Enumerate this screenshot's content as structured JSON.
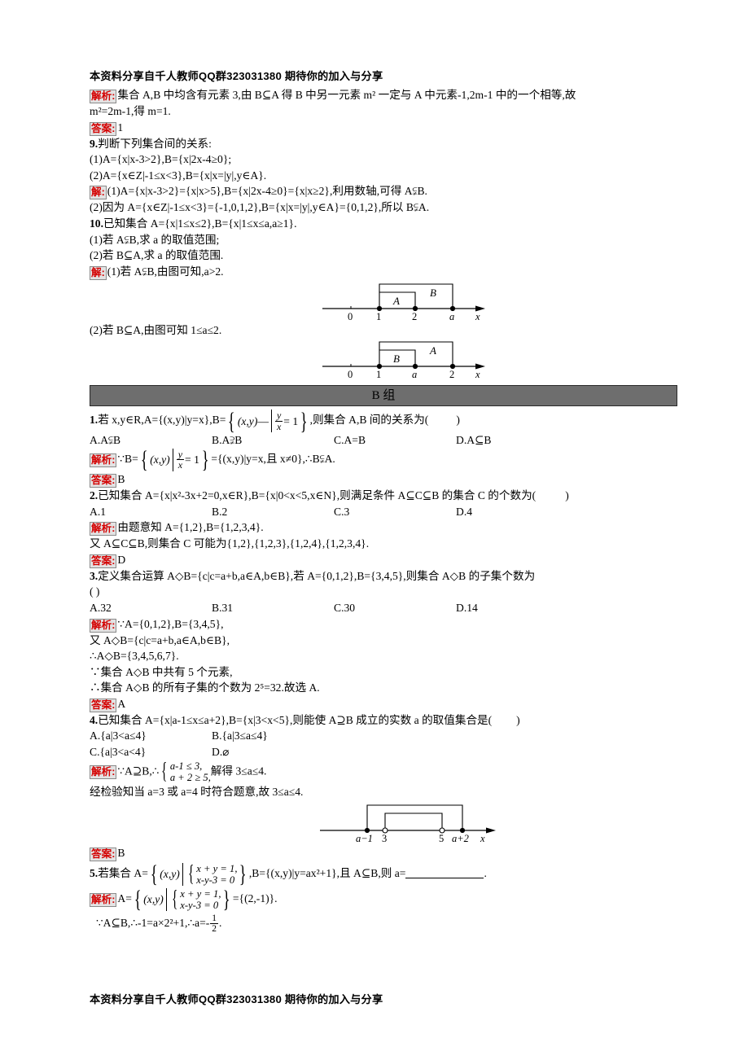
{
  "header": {
    "text": "本资料分享自千人教师QQ群323031380 期待你的加入与分享"
  },
  "footer": {
    "text": "本资料分享自千人教师QQ群323031380 期待你的加入与分享"
  },
  "tags": {
    "analysis": "解析:",
    "solution": "解:",
    "answer": "答案:"
  },
  "section_a_tail": {
    "q8_analysis": "集合 A,B 中均含有元素 3,由 B⊆A 得 B 中另一元素 m² 一定与 A 中元素-1,2m-1 中的一个相等,故",
    "q8_analysis_2": "m²=2m-1,得 m=1.",
    "q8_answer": "1",
    "q9_stem": "判断下列集合间的关系:",
    "q9_num": "9.",
    "q9_sub1": "(1)A={x|x-3>2},B={x|2x-4≥0};",
    "q9_sub2": "(2)A={x∈Z|-1≤x<3},B={x|x=|y|,y∈A}.",
    "q9_sol1": "(1)A={x|x-3>2}={x|x>5},B={x|2x-4≥0}={x|x≥2},利用数轴,可得 A⫋B.",
    "q9_sol2": "(2)因为 A={x∈Z|-1≤x<3}={-1,0,1,2},B={x|x=|y|,y∈A}={0,1,2},所以 B⫋A.",
    "q10_num": "10.",
    "q10_stem": "已知集合 A={x|1≤x≤2},B={x|1≤x≤a,a≥1}.",
    "q10_sub1": "(1)若 A⫋B,求 a 的取值范围;",
    "q10_sub2": "(2)若 B⊆A,求 a 的取值范围.",
    "q10_sol1": "(1)若 A⫋B,由图可知,a>2.",
    "q10_sol2": "(2)若 B⊆A,由图可知 1≤a≤2."
  },
  "band_b": {
    "label": "B 组"
  },
  "section_b": {
    "q1": {
      "num": "1.",
      "stem_pre": "若 x,y∈R,A={(x,y)|y=x},B=",
      "stem_set_lead": "(x,y)",
      "frac_num": "y",
      "frac_den": "x",
      "frac_eq": "= 1",
      "stem_post": ",则集合 A,B 间的关系为(",
      "stem_close": ")",
      "options": [
        "A.A⫋B",
        "B.A⫌B",
        "C.A=B",
        "D.A⊆B"
      ],
      "analysis_pre": "∵B=",
      "analysis_set_lead": "(x,y)",
      "analysis_post": "={(x,y)|y=x,且 x≠0},∴B⫋A.",
      "answer": "B"
    },
    "q2": {
      "num": "2.",
      "stem": "已知集合 A={x|x²-3x+2=0,x∈R},B={x|0<x<5,x∈N},则满足条件 A⊆C⊆B 的集合 C 的个数为(",
      "stem_close": ")",
      "options": [
        "A.1",
        "B.2",
        "C.3",
        "D.4"
      ],
      "analysis1": "由题意知 A={1,2},B={1,2,3,4}.",
      "analysis2": "又 A⊆C⊆B,则集合 C 可能为{1,2},{1,2,3},{1,2,4},{1,2,3,4}.",
      "answer": "D"
    },
    "q3": {
      "num": "3.",
      "stem": "定义集合运算 A◇B={c|c=a+b,a∈A,b∈B},若 A={0,1,2},B={3,4,5},则集合 A◇B 的子集个数为",
      "stem2": "(    )",
      "options": [
        "A.32",
        "B.31",
        "C.30",
        "D.14"
      ],
      "analysis1": "∵A={0,1,2},B={3,4,5},",
      "analysis2": "又 A◇B={c|c=a+b,a∈A,b∈B},",
      "analysis3": "∴A◇B={3,4,5,6,7}.",
      "analysis4": "∵集合 A◇B 中共有 5 个元素,",
      "analysis5": "∴集合 A◇B 的所有子集的个数为 2⁵=32.故选 A.",
      "answer": "A"
    },
    "q4": {
      "num": "4.",
      "stem": "已知集合 A={x|a-1≤x≤a+2},B={x|3<x<5},则能使 A⊇B 成立的实数 a 的取值集合是(",
      "stem_close": ")",
      "options": [
        "A.{a|3<a≤4}",
        "B.{a|3≤a≤4}",
        "C.{a|3<a<4}",
        "D.⌀"
      ],
      "analysis_pre": "∵A⊇B,∴",
      "sys_line1": "a-1 ≤ 3,",
      "sys_line2": "a + 2 ≥ 5,",
      "analysis_post": "解得 3≤a≤4.",
      "analysis2": "经检验知当 a=3 或 a=4 时符合题意,故 3≤a≤4.",
      "answer": "B"
    },
    "q5": {
      "num": "5.",
      "stem_pre": "若集合 A=",
      "set_lead": "(x,y)",
      "sys_line1": "x + y = 1,",
      "sys_line2": "x-y-3 = 0",
      "stem_post": ",B={(x,y)|y=ax²+1},且 A⊆B,则 a=",
      "stem_end": ".",
      "analysis_pre": "A=",
      "analysis_set_lead": "(x,y)",
      "analysis_sys1": "x + y = 1,",
      "analysis_sys2": "x-y-3 = 0",
      "analysis_post": "={(2,-1)}.",
      "analysis2_pre": "∵A⊆B,∴-1=a×2²+1,∴a=-",
      "analysis2_num": "1",
      "analysis2_den": "2",
      "analysis2_end": "."
    }
  },
  "figures": {
    "fig1": {
      "name": "number-line-A-subset-B",
      "ticks": [
        "0",
        "1",
        "2",
        "a"
      ],
      "inner_label": "A",
      "outer_label": "B",
      "axis_label": "x"
    },
    "fig2": {
      "name": "number-line-B-subset-A",
      "ticks": [
        "0",
        "1",
        "a",
        "2"
      ],
      "inner_label": "B",
      "outer_label": "A",
      "axis_label": "x"
    },
    "fig3": {
      "name": "number-line-interval-a",
      "ticks": [
        "a−1",
        "3",
        "5",
        "a+2"
      ],
      "axis_label": "x"
    }
  },
  "colors": {
    "tag_text": "#d40000",
    "tag_bg": "#e3e3e3",
    "band_bg": "#6e6e6e",
    "text": "#000000"
  }
}
